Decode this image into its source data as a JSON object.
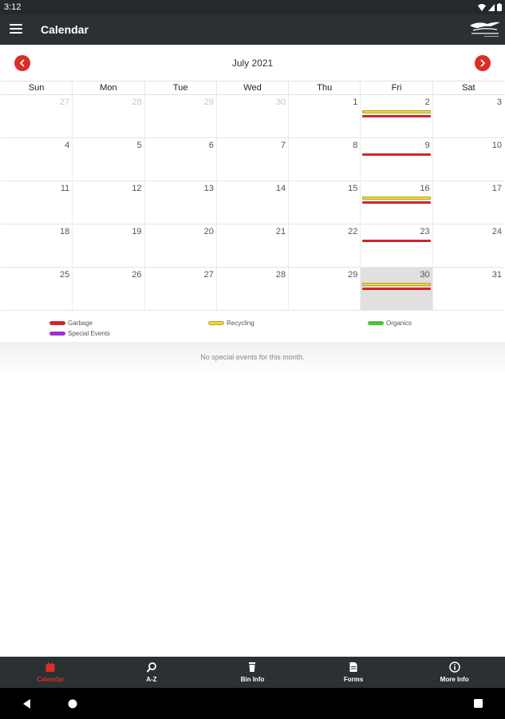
{
  "status_bar": {
    "time": "3:12"
  },
  "app_bar": {
    "title": "Calendar"
  },
  "month": {
    "title": "July 2021"
  },
  "weekdays": [
    "Sun",
    "Mon",
    "Tue",
    "Wed",
    "Thu",
    "Fri",
    "Sat"
  ],
  "weeks": [
    [
      {
        "d": "27",
        "other": true
      },
      {
        "d": "28",
        "other": true
      },
      {
        "d": "29",
        "other": true
      },
      {
        "d": "30",
        "other": true
      },
      {
        "d": "1"
      },
      {
        "d": "2",
        "events": [
          "recycling",
          "garbage"
        ]
      },
      {
        "d": "3"
      }
    ],
    [
      {
        "d": "4"
      },
      {
        "d": "5"
      },
      {
        "d": "6"
      },
      {
        "d": "7"
      },
      {
        "d": "8"
      },
      {
        "d": "9",
        "events": [
          "garbage"
        ]
      },
      {
        "d": "10"
      }
    ],
    [
      {
        "d": "11"
      },
      {
        "d": "12"
      },
      {
        "d": "13"
      },
      {
        "d": "14"
      },
      {
        "d": "15"
      },
      {
        "d": "16",
        "events": [
          "recycling",
          "garbage"
        ]
      },
      {
        "d": "17"
      }
    ],
    [
      {
        "d": "18"
      },
      {
        "d": "19"
      },
      {
        "d": "20"
      },
      {
        "d": "21"
      },
      {
        "d": "22"
      },
      {
        "d": "23",
        "events": [
          "garbage"
        ]
      },
      {
        "d": "24"
      }
    ],
    [
      {
        "d": "25"
      },
      {
        "d": "26"
      },
      {
        "d": "27"
      },
      {
        "d": "28"
      },
      {
        "d": "29"
      },
      {
        "d": "30",
        "events": [
          "recycling",
          "garbage"
        ],
        "today": true
      },
      {
        "d": "31"
      }
    ]
  ],
  "legend": [
    {
      "label": "Garbage",
      "color": "#d3242a"
    },
    {
      "label": "Recycling",
      "color": "#f1d63a"
    },
    {
      "label": "Organics",
      "color": "#4cc23a"
    },
    {
      "label": "Special Events",
      "color": "#9b2fd8"
    }
  ],
  "events": {
    "empty_text": "No special events for this month."
  },
  "bottom_nav": [
    {
      "label": "Calendar",
      "icon": "calendar-icon",
      "active": true
    },
    {
      "label": "A-Z",
      "icon": "search-icon"
    },
    {
      "label": "Bin Info",
      "icon": "bin-icon"
    },
    {
      "label": "Forms",
      "icon": "document-icon"
    },
    {
      "label": "More Info",
      "icon": "info-icon"
    }
  ],
  "colors": {
    "accent": "#d92f27",
    "appbar": "#2b3133",
    "garbage": "#d3242a",
    "recycling": "#f1d63a"
  }
}
